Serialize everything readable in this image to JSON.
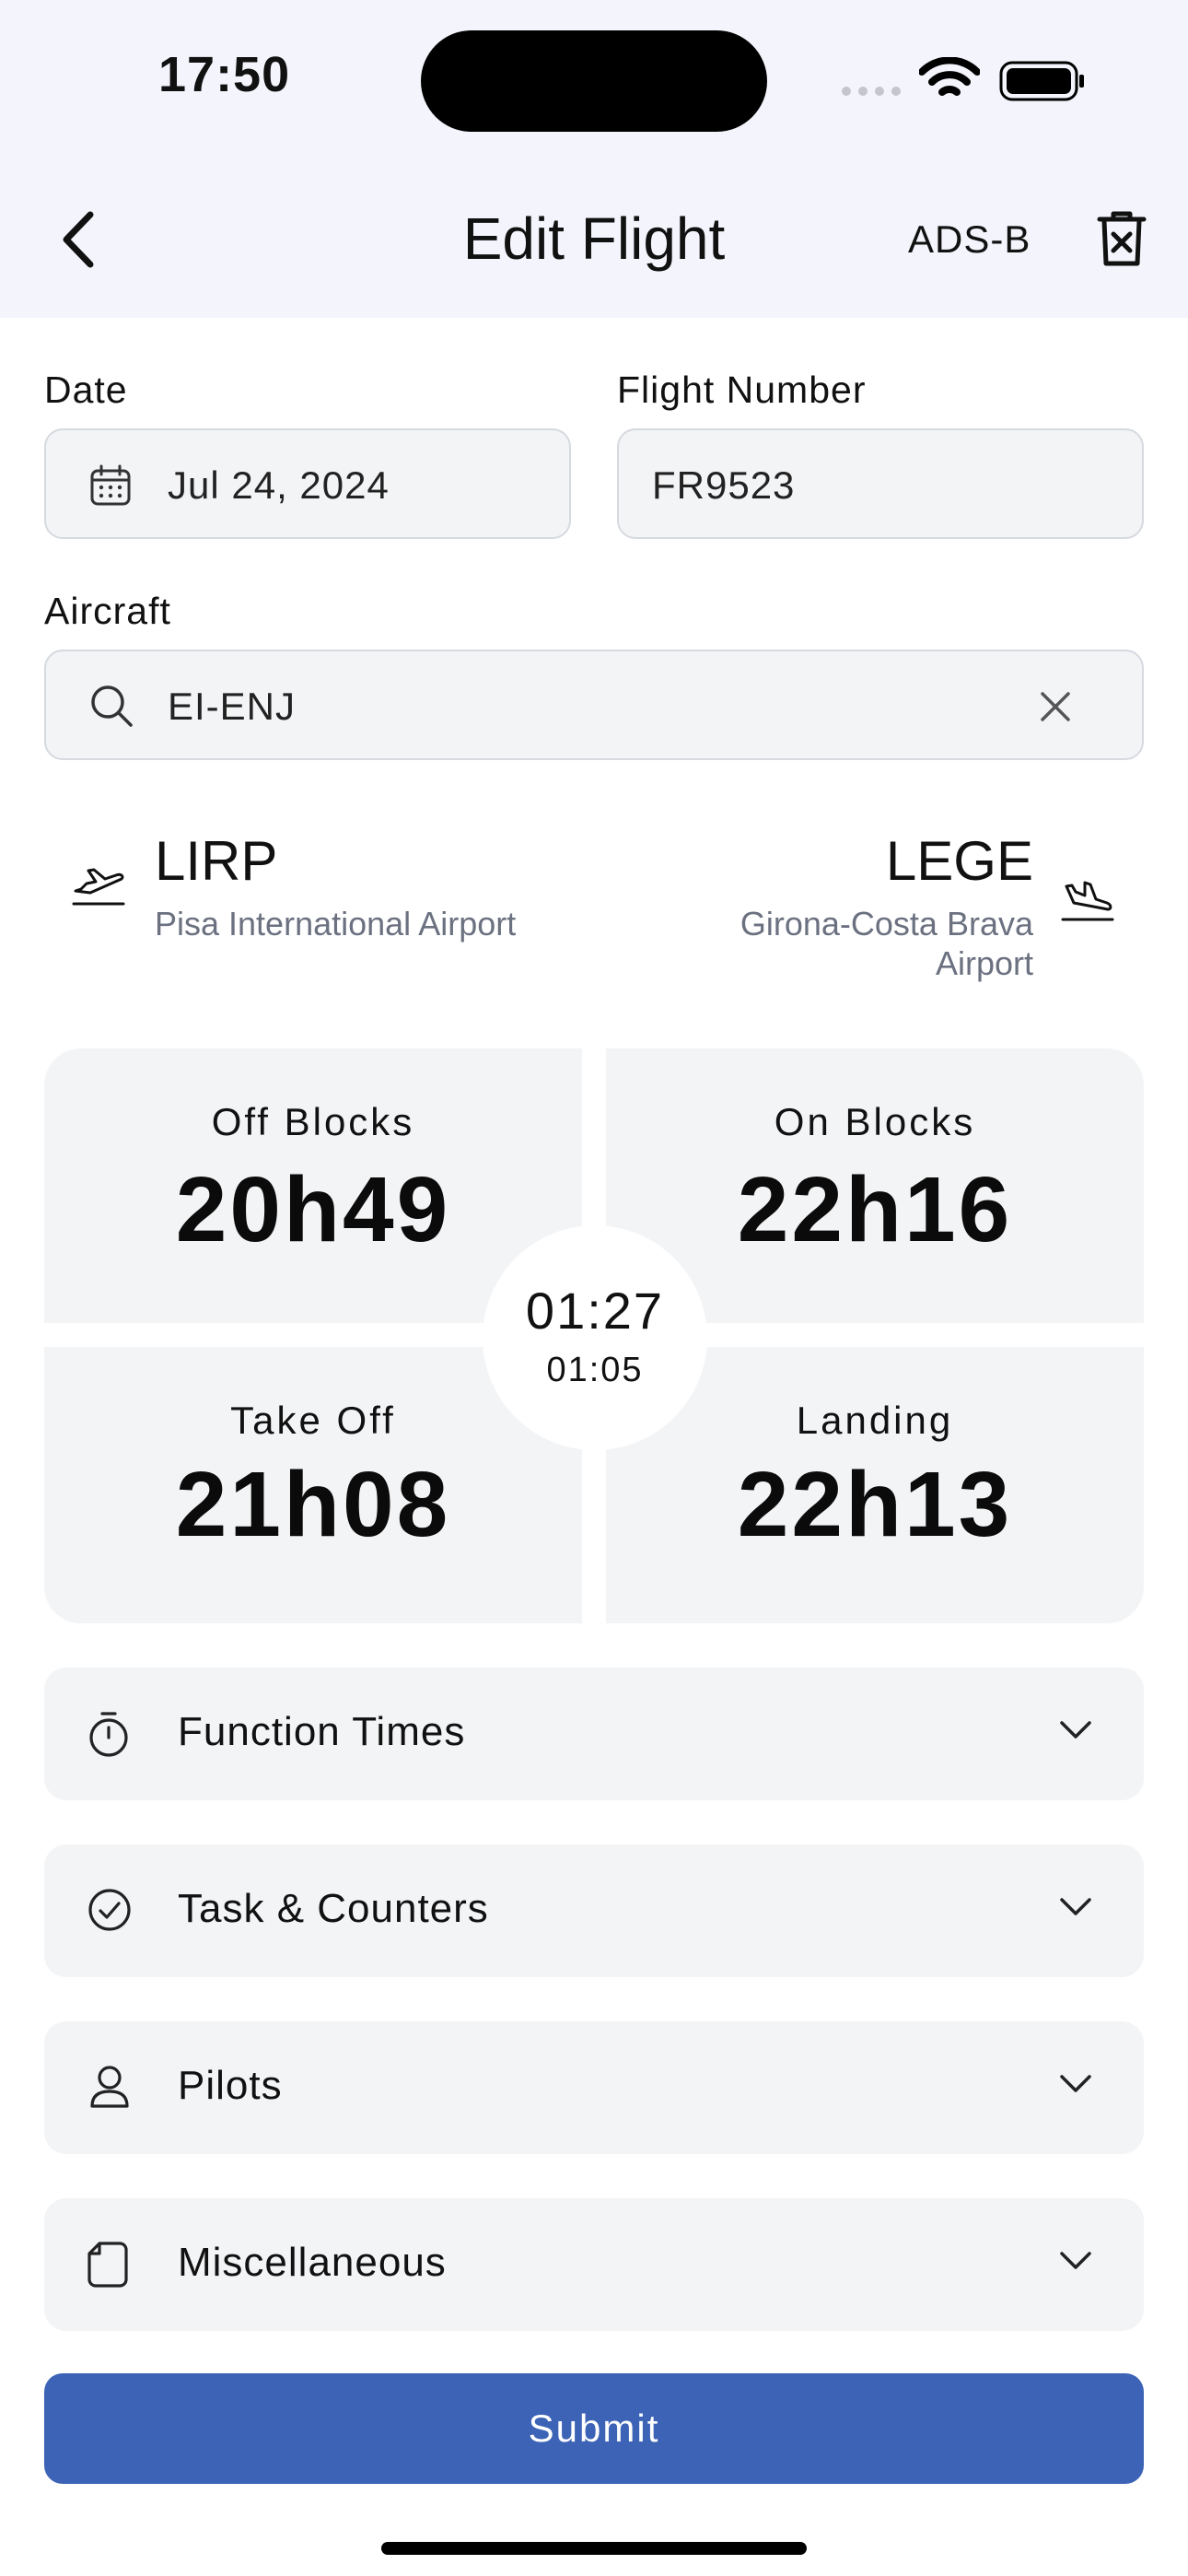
{
  "status_bar": {
    "time": "17:50"
  },
  "header": {
    "title": "Edit Flight",
    "adsb_label": "ADS-B"
  },
  "form": {
    "date_label": "Date",
    "date_value": "Jul 24, 2024",
    "flight_number_label": "Flight Number",
    "flight_number_value": "FR9523",
    "aircraft_label": "Aircraft",
    "aircraft_value": "EI-ENJ"
  },
  "route": {
    "departure": {
      "icao": "LIRP",
      "name": "Pisa International Airport"
    },
    "arrival": {
      "icao": "LEGE",
      "name_line1": "Girona-Costa Brava",
      "name_line2": "Airport"
    }
  },
  "times": {
    "off_blocks_label": "Off Blocks",
    "off_blocks": "20h49",
    "on_blocks_label": "On Blocks",
    "on_blocks": "22h16",
    "take_off_label": "Take Off",
    "take_off": "21h08",
    "landing_label": "Landing",
    "landing": "22h13",
    "block_time": "01:27",
    "flight_time": "01:05"
  },
  "sections": [
    {
      "label": "Function Times",
      "icon": "stopwatch-icon"
    },
    {
      "label": "Task & Counters",
      "icon": "check-circle-icon"
    },
    {
      "label": "Pilots",
      "icon": "person-icon"
    },
    {
      "label": "Miscellaneous",
      "icon": "document-icon"
    }
  ],
  "submit_label": "Submit",
  "colors": {
    "header_bg": "#f4f5fc",
    "field_bg": "#f3f4f6",
    "submit_bg": "#3c63b6",
    "muted_text": "#6b7180"
  }
}
